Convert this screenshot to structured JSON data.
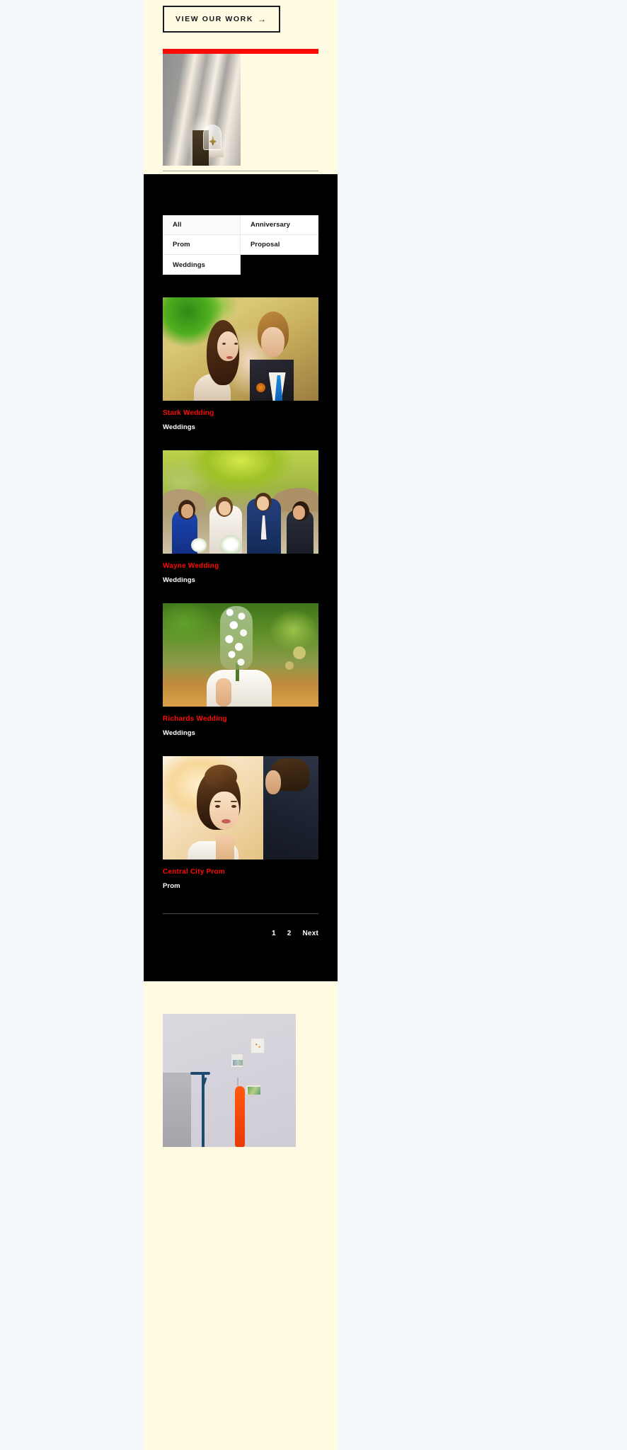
{
  "hero": {
    "cta_label": "VIEW OUR WORK",
    "cta_arrow": "→",
    "accent_red": "#fb0b06",
    "background": "#fffbe2",
    "photo_alt": "cloche-on-pedestal-photo"
  },
  "gallery": {
    "background": "#000000",
    "filters": [
      {
        "label": "All",
        "active": true
      },
      {
        "label": "Anniversary",
        "active": false
      },
      {
        "label": "Prom",
        "active": false
      },
      {
        "label": "Proposal",
        "active": false
      },
      {
        "label": "Weddings",
        "active": false
      }
    ],
    "items": [
      {
        "title": "Stark Wedding",
        "category": "Weddings",
        "photo_alt": "bride-and-groom-embrace-photo"
      },
      {
        "title": "Wayne Wedding",
        "category": "Weddings",
        "photo_alt": "wedding-party-group-photo"
      },
      {
        "title": "Richards Wedding",
        "category": "Weddings",
        "photo_alt": "bride-holding-white-flowers-photo"
      },
      {
        "title": "Central City Prom",
        "category": "Prom",
        "photo_alt": "prom-couple-portrait-photo"
      }
    ],
    "title_color": "#fb0b06",
    "category_color": "#ffffff",
    "pagination": [
      {
        "label": "1",
        "current": true
      },
      {
        "label": "2",
        "current": false
      },
      {
        "label": "Next",
        "current": false
      }
    ]
  },
  "bottom": {
    "background": "#fffbe2",
    "photo_alt": "wall-with-kayak-and-prints-photo"
  }
}
